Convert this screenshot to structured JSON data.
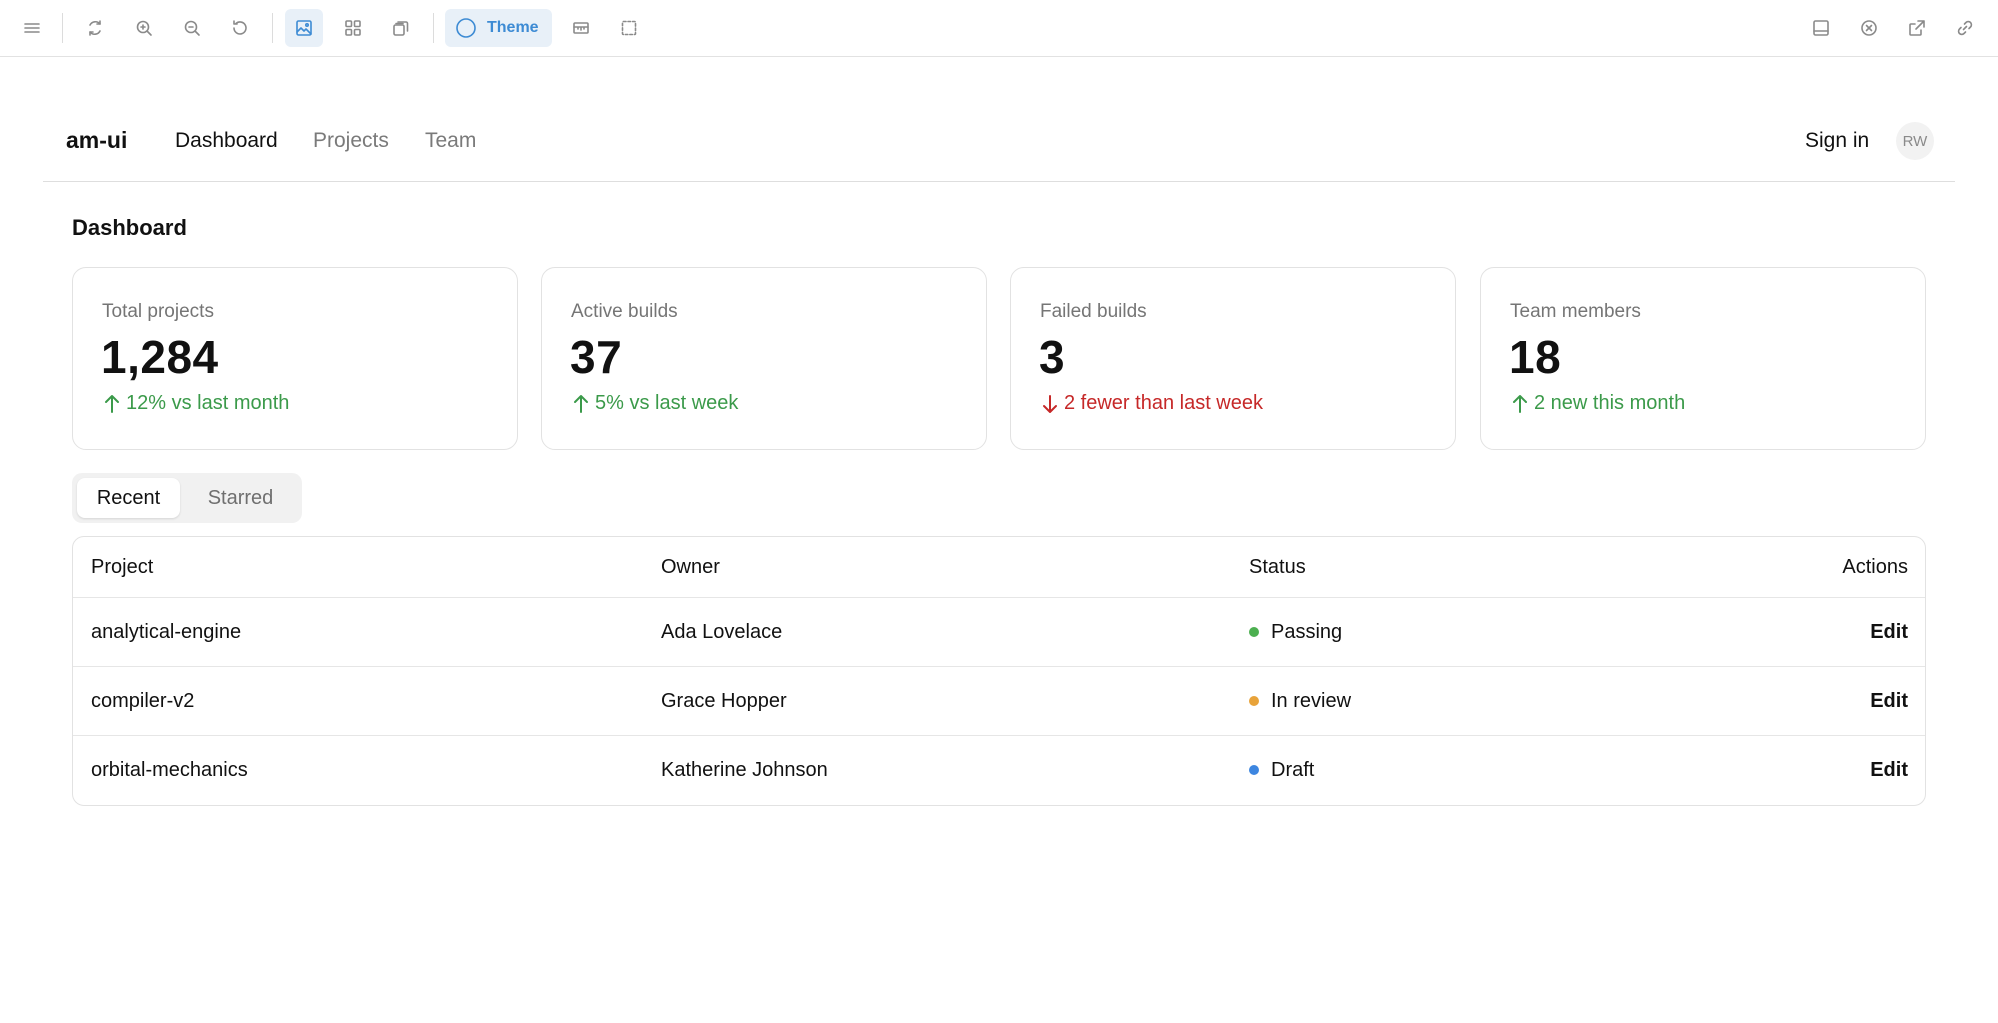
{
  "toolbar": {
    "theme_label": "Theme"
  },
  "header": {
    "brand": "am-ui",
    "nav": [
      {
        "label": "Dashboard",
        "current": true
      },
      {
        "label": "Projects",
        "current": false
      },
      {
        "label": "Team",
        "current": false
      }
    ],
    "sign_in": "Sign in",
    "avatar_initials": "RW"
  },
  "page": {
    "title": "Dashboard"
  },
  "stats": [
    {
      "label": "Total projects",
      "value": "1,284",
      "trend": "12% vs last month",
      "direction": "up"
    },
    {
      "label": "Active builds",
      "value": "37",
      "trend": "5% vs last week",
      "direction": "up"
    },
    {
      "label": "Failed builds",
      "value": "3",
      "trend": "2 fewer than last week",
      "direction": "down"
    },
    {
      "label": "Team members",
      "value": "18",
      "trend": "2 new this month",
      "direction": "up"
    }
  ],
  "tabs": [
    {
      "label": "Recent",
      "selected": true
    },
    {
      "label": "Starred",
      "selected": false
    }
  ],
  "table": {
    "columns": [
      "Project",
      "Owner",
      "Status",
      "Actions"
    ],
    "rows": [
      {
        "project": "analytical-engine",
        "owner": "Ada Lovelace",
        "status": "Passing",
        "status_color": "#4caf50",
        "action": "Edit"
      },
      {
        "project": "compiler-v2",
        "owner": "Grace Hopper",
        "status": "In review",
        "status_color": "#e8a33a",
        "action": "Edit"
      },
      {
        "project": "orbital-mechanics",
        "owner": "Katherine Johnson",
        "status": "Draft",
        "status_color": "#3d86e0",
        "action": "Edit"
      }
    ]
  },
  "colors": {
    "accent": "#3d8bd4",
    "up": "#3b9a4a",
    "down": "#c62828"
  }
}
